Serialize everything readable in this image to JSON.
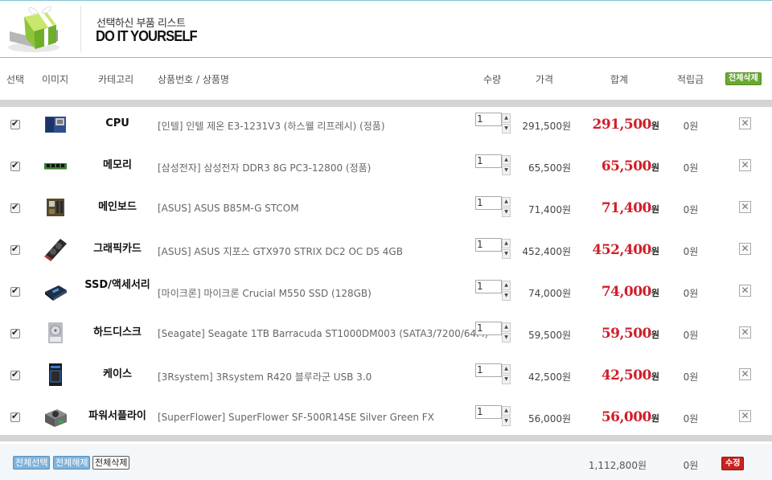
{
  "header": {
    "subtitle": "선택하신 부품 리스트",
    "title": "DO IT YOURSELF",
    "logo_icon": "gift-box-icon"
  },
  "columns": {
    "select": "선택",
    "image": "이미지",
    "category": "카테고리",
    "product": "상품번호 / 상품명",
    "quantity": "수량",
    "price": "가격",
    "total": "합계",
    "points": "적립금",
    "delete_all": "전체삭제"
  },
  "items": [
    {
      "category": "CPU",
      "name": "[인텔] 인텔 제온 E3-1231V3 (하스웰 리프레시) (정품)",
      "qty": "1",
      "price": "291,500원",
      "total": "291,500",
      "won": "원",
      "points": "0원",
      "checked": true,
      "icon": "cpu-icon"
    },
    {
      "category": "메모리",
      "name": "[삼성전자] 삼성전자 DDR3 8G PC3-12800 (정품)",
      "qty": "1",
      "price": "65,500원",
      "total": "65,500",
      "won": "원",
      "points": "0원",
      "checked": true,
      "icon": "memory-icon"
    },
    {
      "category": "메인보드",
      "name": "[ASUS] ASUS B85M-G STCOM",
      "qty": "1",
      "price": "71,400원",
      "total": "71,400",
      "won": "원",
      "points": "0원",
      "checked": true,
      "icon": "mainboard-icon"
    },
    {
      "category": "그래픽카드",
      "name": "[ASUS] ASUS 지포스 GTX970 STRIX DC2 OC D5 4GB",
      "qty": "1",
      "price": "452,400원",
      "total": "452,400",
      "won": "원",
      "points": "0원",
      "checked": true,
      "icon": "graphics-card-icon"
    },
    {
      "category": "SSD/액세서리",
      "name": "[마이크론] 마이크론 Crucial M550 SSD (128GB)",
      "qty": "1",
      "price": "74,000원",
      "total": "74,000",
      "won": "원",
      "points": "0원",
      "checked": true,
      "icon": "ssd-icon"
    },
    {
      "category": "하드디스크",
      "name": "[Seagate] Seagate 1TB Barracuda ST1000DM003 (SATA3/7200/64M)",
      "qty": "1",
      "price": "59,500원",
      "total": "59,500",
      "won": "원",
      "points": "0원",
      "checked": true,
      "icon": "hard-disk-icon"
    },
    {
      "category": "케이스",
      "name": "[3Rsystem] 3Rsystem R420 블루라군 USB 3.0",
      "qty": "1",
      "price": "42,500원",
      "total": "42,500",
      "won": "원",
      "points": "0원",
      "checked": true,
      "icon": "pc-case-icon"
    },
    {
      "category": "파워서플라이",
      "name": "[SuperFlower] SuperFlower SF-500R14SE Silver Green FX",
      "qty": "1",
      "price": "56,000원",
      "total": "56,000",
      "won": "원",
      "points": "0원",
      "checked": true,
      "icon": "power-supply-icon"
    }
  ],
  "footer": {
    "select_all": "전체선택",
    "deselect_all": "전체해제",
    "delete_all": "전체삭제",
    "grand_total": "1,112,800원",
    "points": "0원",
    "edit": "수정"
  },
  "colors": {
    "accent_teal": "#7fc3d0",
    "total_red": "#d01f2a",
    "delete_green": "#6aa832",
    "edit_red": "#c8231f"
  }
}
